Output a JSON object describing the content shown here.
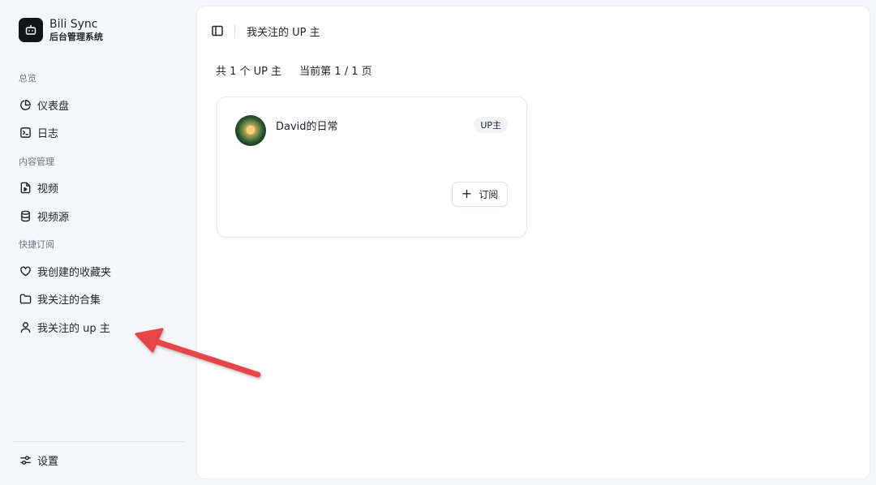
{
  "brand": {
    "title": "Bili Sync",
    "subtitle": "后台管理系统"
  },
  "sidebar": {
    "groups": [
      {
        "label": "总览"
      },
      {
        "label": "内容管理"
      },
      {
        "label": "快捷订阅"
      }
    ],
    "items": [
      {
        "label": "仪表盘",
        "icon": "pie-chart-icon"
      },
      {
        "label": "日志",
        "icon": "terminal-icon"
      },
      {
        "label": "视频",
        "icon": "video-file-icon"
      },
      {
        "label": "视频源",
        "icon": "database-icon"
      },
      {
        "label": "我创建的收藏夹",
        "icon": "heart-icon"
      },
      {
        "label": "我关注的合集",
        "icon": "folder-icon"
      },
      {
        "label": "我关注的 up 主",
        "icon": "user-icon"
      }
    ],
    "footer": {
      "label": "设置",
      "icon": "settings-sliders-icon"
    }
  },
  "header": {
    "breadcrumb": "我关注的 UP 主"
  },
  "summary": {
    "total": "共 1 个 UP 主",
    "page": "当前第 1 / 1 页"
  },
  "cards": [
    {
      "name": "David的日常",
      "badge": "UP主",
      "subscribe_label": "订阅"
    }
  ],
  "colors": {
    "arrow": "#e8454a",
    "brand_bg": "#111418"
  }
}
